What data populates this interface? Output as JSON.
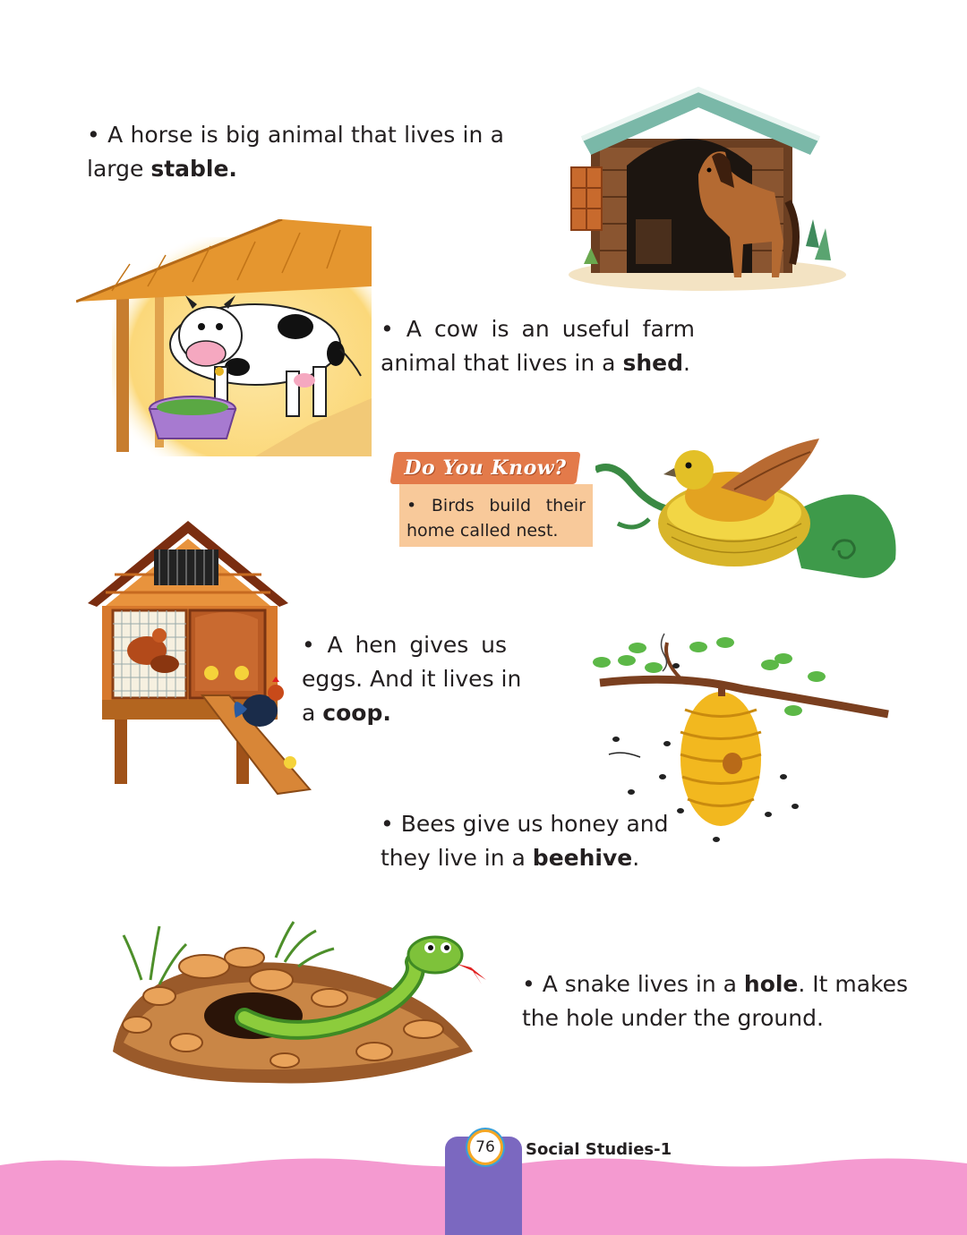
{
  "horse": {
    "line1": "• A horse is big animal that lives in a",
    "line2_pre": "large ",
    "line2_bold": "stable."
  },
  "cow": {
    "line1": "• A cow is an useful farm",
    "line2_pre": "animal that lives in a ",
    "line2_bold": "shed",
    "line2_post": "."
  },
  "dyk": {
    "title": "Do You Know?",
    "line1": "• Birds build their",
    "line2": "home called nest."
  },
  "hen": {
    "line1": "• A hen gives us",
    "line2": "eggs. And it lives in",
    "line3_pre": "a ",
    "line3_bold": "coop."
  },
  "bee": {
    "line1": "• Bees give us honey and",
    "line2_pre": "they live in a ",
    "line2_bold": "beehive",
    "line2_post": "."
  },
  "snake": {
    "line1_pre": "• A snake lives in a ",
    "line1_bold": "hole",
    "line1_post": ". It makes",
    "line2": "the hole under the ground."
  },
  "footer": {
    "page_number": "76",
    "book_title": "Social Studies-1"
  },
  "colors": {
    "footer_pink": "#f49ad0",
    "footer_tab": "#7b68c0",
    "dyk_title": "#e37a4a",
    "dyk_box": "#f8c99a"
  },
  "icons": [
    "stable-illustration",
    "cow-shed-illustration",
    "bird-nest-illustration",
    "hen-coop-illustration",
    "beehive-illustration",
    "snake-hole-illustration"
  ]
}
